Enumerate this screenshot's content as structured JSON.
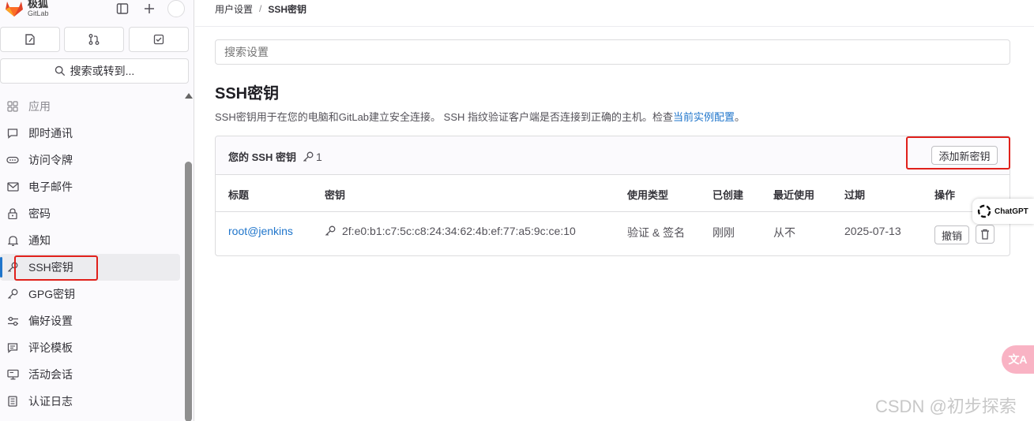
{
  "brand": {
    "name": "极狐",
    "sub": "GitLab"
  },
  "sidebar": {
    "search_label": "搜索或转到...",
    "items": [
      {
        "label": "应用",
        "icon": "apps-icon"
      },
      {
        "label": "即时通讯",
        "icon": "chat-icon"
      },
      {
        "label": "访问令牌",
        "icon": "token-icon"
      },
      {
        "label": "电子邮件",
        "icon": "mail-icon"
      },
      {
        "label": "密码",
        "icon": "lock-icon"
      },
      {
        "label": "通知",
        "icon": "bell-icon"
      },
      {
        "label": "SSH密钥",
        "icon": "key-icon",
        "active": true
      },
      {
        "label": "GPG密钥",
        "icon": "key-icon"
      },
      {
        "label": "偏好设置",
        "icon": "preferences-icon"
      },
      {
        "label": "评论模板",
        "icon": "comment-icon"
      },
      {
        "label": "活动会话",
        "icon": "monitor-icon"
      },
      {
        "label": "认证日志",
        "icon": "log-icon"
      }
    ]
  },
  "breadcrumb": {
    "parent": "用户设置",
    "sep": "/",
    "current": "SSH密钥"
  },
  "search": {
    "placeholder": "搜索设置"
  },
  "page": {
    "title": "SSH密钥",
    "desc_before": "SSH密钥用于在您的电脑和GitLab建立安全连接。 SSH 指纹验证客户端是否连接到正确的主机。检查",
    "desc_link": "当前实例配置",
    "desc_after": "。"
  },
  "card": {
    "title": "您的 SSH 密钥",
    "count": "1",
    "add_button": "添加新密钥",
    "columns": [
      "标题",
      "密钥",
      "使用类型",
      "已创建",
      "最近使用",
      "过期",
      "操作"
    ],
    "row": {
      "title": "root@jenkins",
      "fingerprint": "2f:e0:b1:c7:5c:c8:24:34:62:4b:ef:77:a5:9c:ce:10",
      "usage": "验证 & 签名",
      "created": "刚刚",
      "last_used": "从不",
      "expires": "2025-07-13",
      "revoke": "撤销"
    }
  },
  "overlays": {
    "chatgpt": "ChatGPT",
    "translate": "文A",
    "watermark": "CSDN @初步探索"
  },
  "colors": {
    "accent": "#1f75cb",
    "highlight_box": "#e0201b",
    "logo": "#e24329"
  }
}
